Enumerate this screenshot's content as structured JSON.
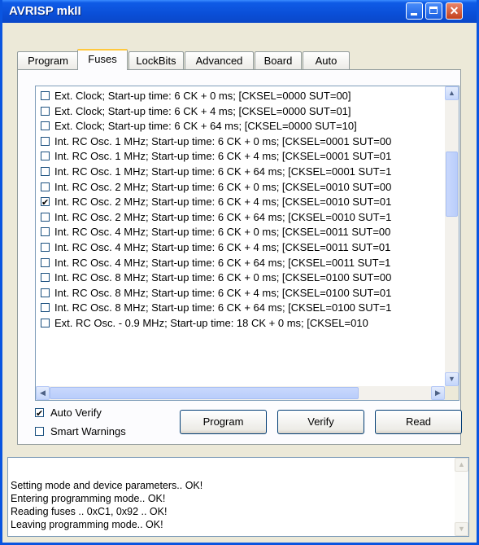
{
  "window": {
    "title": "AVRISP mkII",
    "min_label": "_",
    "max_label": "□",
    "close_label": "✕"
  },
  "tabs": [
    {
      "label": "Program"
    },
    {
      "label": "Fuses",
      "active": true
    },
    {
      "label": "LockBits"
    },
    {
      "label": "Advanced"
    },
    {
      "label": "Board"
    },
    {
      "label": "Auto"
    }
  ],
  "fuse_list": [
    {
      "text": "Ext. Clock; Start-up time: 6 CK + 0 ms; [CKSEL=0000 SUT=00]",
      "checked": false
    },
    {
      "text": "Ext. Clock; Start-up time: 6 CK + 4 ms; [CKSEL=0000 SUT=01]",
      "checked": false
    },
    {
      "text": "Ext. Clock; Start-up time: 6 CK + 64 ms; [CKSEL=0000 SUT=10]",
      "checked": false
    },
    {
      "text": "Int. RC Osc. 1 MHz; Start-up time: 6 CK + 0 ms; [CKSEL=0001 SUT=00",
      "checked": false
    },
    {
      "text": "Int. RC Osc. 1 MHz; Start-up time: 6 CK + 4 ms; [CKSEL=0001 SUT=01",
      "checked": false
    },
    {
      "text": "Int. RC Osc. 1 MHz; Start-up time: 6 CK + 64 ms; [CKSEL=0001 SUT=1",
      "checked": false
    },
    {
      "text": "Int. RC Osc. 2 MHz; Start-up time: 6 CK + 0 ms; [CKSEL=0010 SUT=00",
      "checked": false
    },
    {
      "text": "Int. RC Osc. 2 MHz; Start-up time: 6 CK + 4 ms; [CKSEL=0010 SUT=01",
      "checked": true
    },
    {
      "text": "Int. RC Osc. 2 MHz; Start-up time: 6 CK + 64 ms; [CKSEL=0010 SUT=1",
      "checked": false
    },
    {
      "text": "Int. RC Osc. 4 MHz; Start-up time: 6 CK + 0 ms; [CKSEL=0011 SUT=00",
      "checked": false
    },
    {
      "text": "Int. RC Osc. 4 MHz; Start-up time: 6 CK + 4 ms; [CKSEL=0011 SUT=01",
      "checked": false
    },
    {
      "text": "Int. RC Osc. 4 MHz; Start-up time: 6 CK + 64 ms; [CKSEL=0011 SUT=1",
      "checked": false
    },
    {
      "text": "Int. RC Osc. 8 MHz; Start-up time: 6 CK + 0 ms; [CKSEL=0100 SUT=00",
      "checked": false
    },
    {
      "text": "Int. RC Osc. 8 MHz; Start-up time: 6 CK + 4 ms; [CKSEL=0100 SUT=01",
      "checked": false
    },
    {
      "text": "Int. RC Osc. 8 MHz; Start-up time: 6 CK + 64 ms; [CKSEL=0100 SUT=1",
      "checked": false
    },
    {
      "text": "Ext. RC Osc.       - 0.9 MHz; Start-up time: 18 CK + 0 ms; [CKSEL=010",
      "checked": false
    }
  ],
  "options": {
    "auto_verify": {
      "label": "Auto Verify",
      "checked": true
    },
    "smart_warnings": {
      "label": "Smart Warnings",
      "checked": false
    }
  },
  "buttons": {
    "program": "Program",
    "verify": "Verify",
    "read": "Read"
  },
  "scroll_icons": {
    "up": "▲",
    "down": "▼",
    "left": "◀",
    "right": "▶"
  },
  "log": [
    "Setting mode and device parameters.. OK!",
    "Entering programming mode.. OK!",
    "Reading fuses .. 0xC1, 0x92 .. OK!",
    "Leaving programming mode.. OK!"
  ],
  "colors": {
    "titlebar": "#0a4fd8",
    "face": "#ece9d8",
    "tab_highlight": "#ffc83c"
  }
}
